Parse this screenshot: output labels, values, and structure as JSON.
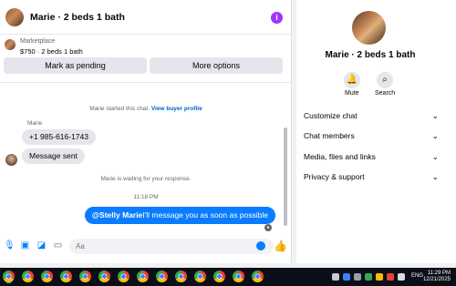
{
  "header": {
    "title": "Marie · 2 beds 1 bath",
    "info_icon": "info-icon"
  },
  "listing": {
    "source": "Marketplace",
    "price_line": "$750 · 2 beds 1 bath",
    "pending_button": "Mark as pending",
    "more_button": "More options"
  },
  "messages": {
    "started_text": "Marie started this chat.",
    "view_profile": "View buyer profile",
    "sender_name": "Marie",
    "phone": "+1 985-616-1743",
    "sent_notice": "Message sent",
    "waiting_text": "Marie is waiting for your response.",
    "time": "11:18 PM",
    "out_mention": "@Stelly Marie",
    "out_text": "I'll message you as soon as possible"
  },
  "composer": {
    "placeholder": "Aa"
  },
  "right_panel": {
    "title": "Marie · 2 beds 1 bath",
    "mute_label": "Mute",
    "search_label": "Search",
    "menu": [
      {
        "label": "Customize chat"
      },
      {
        "label": "Chat members"
      },
      {
        "label": "Media, files and links"
      },
      {
        "label": "Privacy & support"
      }
    ]
  },
  "taskbar": {
    "lang": "ENG",
    "time": "11:29 PM",
    "date": "12/21/2025"
  },
  "colors": {
    "accent": "#0a7cff",
    "info": "#a033ff"
  }
}
